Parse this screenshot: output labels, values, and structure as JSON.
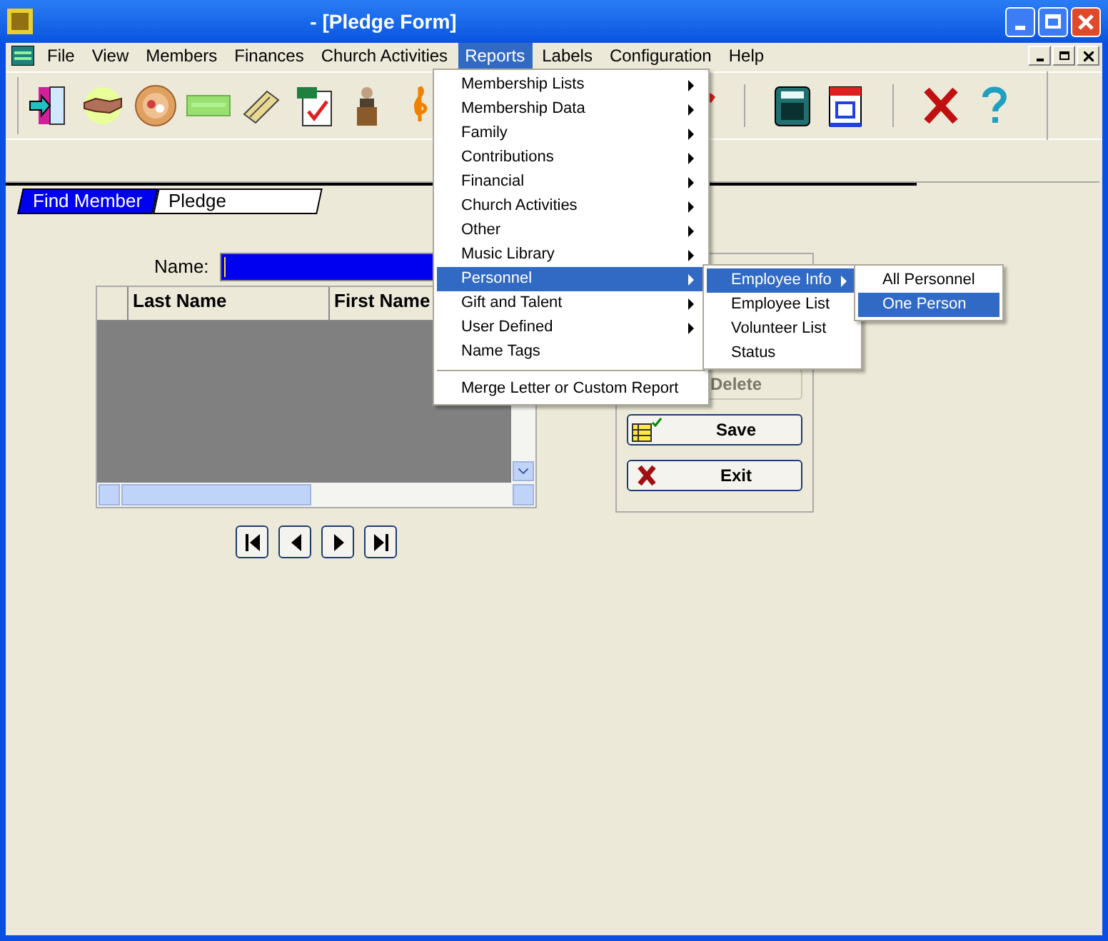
{
  "window": {
    "title": "- [Pledge Form]"
  },
  "menu_bar": [
    {
      "label": "File",
      "selected": false
    },
    {
      "label": "View",
      "selected": false
    },
    {
      "label": "Members",
      "selected": false
    },
    {
      "label": "Finances",
      "selected": false
    },
    {
      "label": "Church Activities",
      "selected": false
    },
    {
      "label": "Reports",
      "selected": true
    },
    {
      "label": "Labels",
      "selected": false
    },
    {
      "label": "Configuration",
      "selected": false
    },
    {
      "label": "Help",
      "selected": false
    }
  ],
  "reports_menu": [
    {
      "kind": "item",
      "label": "Membership Lists",
      "has_submenu": true,
      "selected": false
    },
    {
      "kind": "item",
      "label": "Membership Data",
      "has_submenu": true,
      "selected": false
    },
    {
      "kind": "item",
      "label": "Family",
      "has_submenu": true,
      "selected": false
    },
    {
      "kind": "item",
      "label": "Contributions",
      "has_submenu": true,
      "selected": false
    },
    {
      "kind": "item",
      "label": "Financial",
      "has_submenu": true,
      "selected": false
    },
    {
      "kind": "item",
      "label": "Church Activities",
      "has_submenu": true,
      "selected": false
    },
    {
      "kind": "item",
      "label": "Other",
      "has_submenu": true,
      "selected": false
    },
    {
      "kind": "item",
      "label": "Music Library",
      "has_submenu": true,
      "selected": false
    },
    {
      "kind": "item",
      "label": "Personnel",
      "has_submenu": true,
      "selected": true
    },
    {
      "kind": "item",
      "label": "Gift and Talent",
      "has_submenu": true,
      "selected": false
    },
    {
      "kind": "item",
      "label": "User Defined",
      "has_submenu": true,
      "selected": false
    },
    {
      "kind": "item",
      "label": "Name Tags",
      "has_submenu": false,
      "selected": false
    },
    {
      "kind": "separator"
    },
    {
      "kind": "item",
      "label": "Merge Letter or Custom Report",
      "has_submenu": false,
      "selected": false
    }
  ],
  "personnel_menu": [
    {
      "label": "Employee Info",
      "has_submenu": true,
      "selected": true
    },
    {
      "label": "Employee List",
      "has_submenu": false,
      "selected": false
    },
    {
      "label": "Volunteer List",
      "has_submenu": false,
      "selected": false
    },
    {
      "label": "Status",
      "has_submenu": false,
      "selected": false
    }
  ],
  "employee_info_menu": [
    {
      "label": "All Personnel",
      "selected": false
    },
    {
      "label": "One Person",
      "selected": true
    }
  ],
  "tabs": [
    {
      "label": "Find Member",
      "selected": true
    },
    {
      "label": "Pledge",
      "selected": false
    }
  ],
  "name_field": {
    "label": "Name:"
  },
  "table": {
    "columns": [
      "Last Name",
      "First Name"
    ]
  },
  "buttons": [
    {
      "label": "Delete",
      "disabled": true,
      "kind": "plain"
    },
    {
      "label": "Save",
      "disabled": false,
      "kind": "save"
    },
    {
      "label": "Exit",
      "disabled": false,
      "kind": "exit"
    }
  ]
}
